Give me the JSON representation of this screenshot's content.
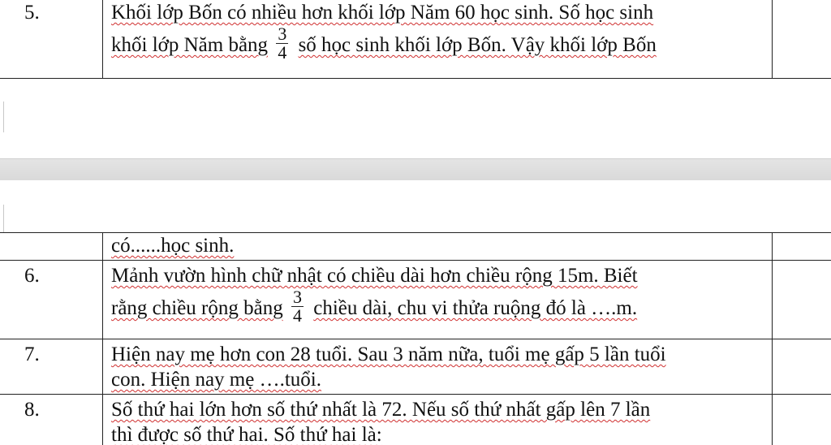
{
  "page1": {
    "rows": [
      {
        "num": "5.",
        "line1": "Khối lớp Bốn có nhiều hơn khối lớp Năm 60 học sinh. Số học sinh",
        "line2_before": "khối lớp Năm bằng",
        "frac_num": "3",
        "frac_den": "4",
        "line2_after": "số học sinh khối lớp Bốn. Vậy khối lớp Bốn"
      }
    ]
  },
  "page2": {
    "row_cont": {
      "num": "",
      "text": "có......học sinh."
    },
    "row6": {
      "num": "6.",
      "line1": "Mảnh vườn hình chữ nhật có chiều dài hơn chiều rộng 15m. Biết",
      "line2_before": "rằng chiều rộng bằng",
      "frac_num": "3",
      "frac_den": "4",
      "line2_after": "chiều dài, chu vi thửa ruộng đó là ….m."
    },
    "row7": {
      "num": "7.",
      "line1": "Hiện nay mẹ hơn con 28 tuổi. Sau 3 năm nữa, tuổi mẹ gấp 5 lần tuổi",
      "line2": "con. Hiện nay mẹ ….tuổi."
    },
    "row8": {
      "num": "8.",
      "line1": "Số thứ hai lớn hơn số thứ nhất là 72. Nếu số thứ nhất gấp lên 7 lần",
      "line2": "thì được số thứ hai. Số thứ hai là:"
    }
  }
}
